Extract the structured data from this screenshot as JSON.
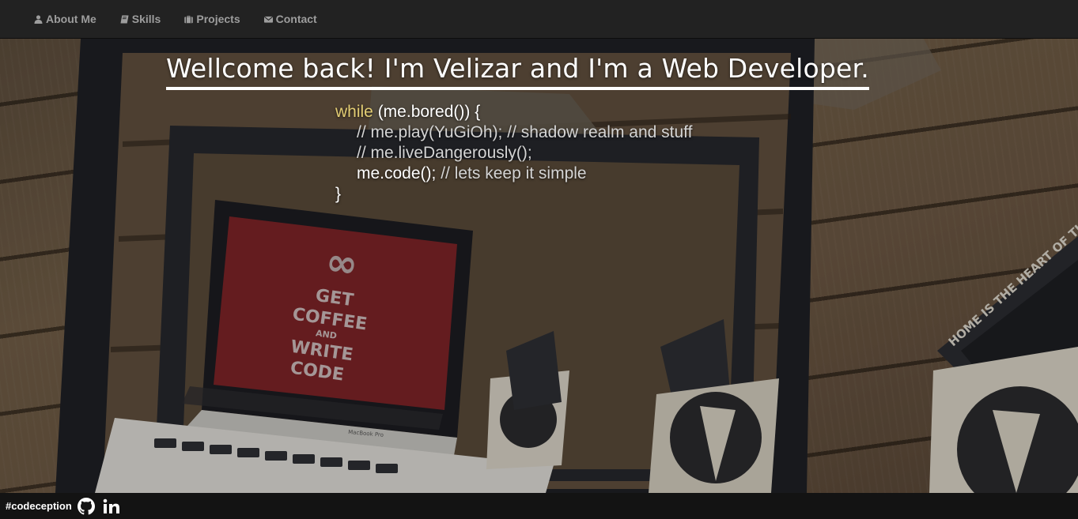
{
  "nav": {
    "items": [
      {
        "label": "About Me",
        "icon": "user-icon"
      },
      {
        "label": "Skills",
        "icon": "book-icon"
      },
      {
        "label": "Projects",
        "icon": "briefcase-icon"
      },
      {
        "label": "Contact",
        "icon": "envelope-icon"
      }
    ]
  },
  "hero": {
    "title": "Wellcome back! I'm Velizar and I'm a Web Developer.",
    "code": {
      "keyword": "while",
      "condition": " (me.bored()) {",
      "line2": "// me.play(YuGiOh); // shadow realm and stuff",
      "line3": "// me.liveDangerously();",
      "line4_code": "me.code();",
      "line4_comment": " // lets keep it simple",
      "close": "}"
    },
    "background": {
      "screen_text": [
        "GET",
        "COFFEE",
        "AND",
        "WRITE",
        "CODE"
      ],
      "laptop_label": "MacBook Pro",
      "coaster_text": "HOME IS THE HEART OF THE HOLIDAYS"
    }
  },
  "footer": {
    "hashtag": "#codeception",
    "links": [
      {
        "name": "github",
        "icon": "github-icon"
      },
      {
        "name": "linkedin",
        "icon": "linkedin-icon"
      }
    ]
  },
  "colors": {
    "navbar_bg": "#222222",
    "nav_text": "#9d9d9d",
    "footer_bg": "#131313",
    "code_keyword": "#e2cc73",
    "screen_red": "#7a2327"
  }
}
